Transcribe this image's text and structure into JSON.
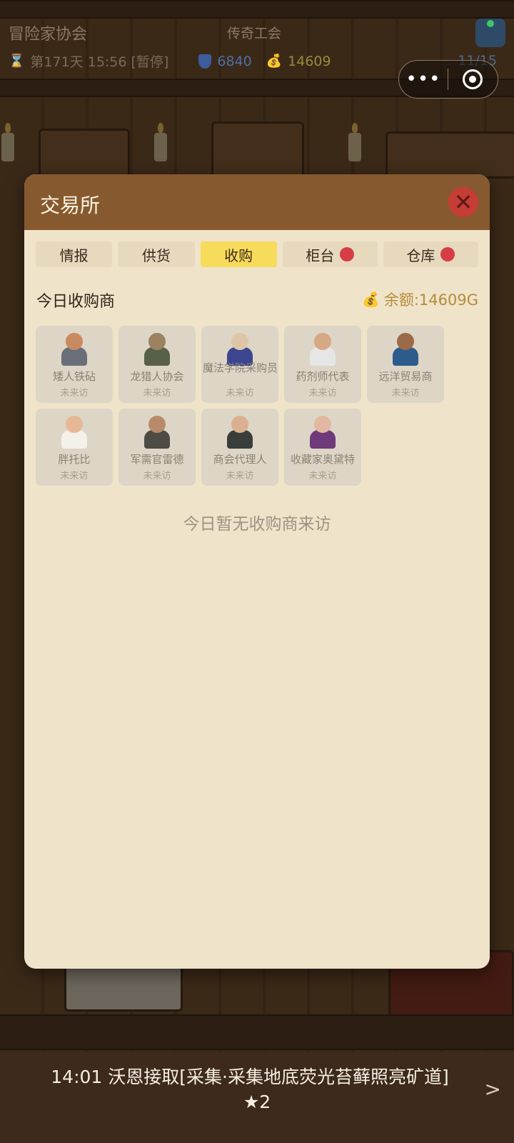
{
  "hud": {
    "guild_name": "冒险家协会",
    "guild_rank": "传奇工会",
    "day_time": "第171天 15:56 [暂停]",
    "reputation": "6840",
    "gold": "14609",
    "members": "11/15"
  },
  "modal": {
    "title": "交易所",
    "tabs": [
      {
        "label": "情报",
        "active": false,
        "badge": false
      },
      {
        "label": "供货",
        "active": false,
        "badge": false
      },
      {
        "label": "收购",
        "active": true,
        "badge": false
      },
      {
        "label": "柜台",
        "active": false,
        "badge": true
      },
      {
        "label": "仓库",
        "active": false,
        "badge": true
      }
    ],
    "section_title": "今日收购商",
    "balance": "余额:14609G",
    "buyers": [
      {
        "name": "矮人铁砧",
        "status": "未来访",
        "skin": "#c98a62",
        "outfit": "#6a6e78"
      },
      {
        "name": "龙猎人协会",
        "status": "未来访",
        "skin": "#9b8260",
        "outfit": "#58604a"
      },
      {
        "name": "魔法学院采购员",
        "status": "未来访",
        "skin": "#e0c6a8",
        "outfit": "#3c4690"
      },
      {
        "name": "药剂师代表",
        "status": "未来访",
        "skin": "#d7a884",
        "outfit": "#e6e6e6"
      },
      {
        "name": "远洋贸易商",
        "status": "未来访",
        "skin": "#9c6a46",
        "outfit": "#2d5b8c"
      },
      {
        "name": "胖托比",
        "status": "未来访",
        "skin": "#e7b896",
        "outfit": "#f4f0ea"
      },
      {
        "name": "军需官雷德",
        "status": "未来访",
        "skin": "#b98a6a",
        "outfit": "#4e4a44"
      },
      {
        "name": "商会代理人",
        "status": "未来访",
        "skin": "#d9b090",
        "outfit": "#3a3e3a"
      },
      {
        "name": "收藏家奥黛特",
        "status": "未来访",
        "skin": "#e2b8a0",
        "outfit": "#6e3a7a"
      }
    ],
    "empty_message": "今日暂无收购商来访"
  },
  "ticker": {
    "line1": "14:01 沃恩接取[采集·采集地底荧光苔藓照亮矿道]",
    "line2": "★2"
  },
  "colors": {
    "header": "#87592e",
    "panel": "#efe3ca",
    "active_tab": "#f7db5a",
    "badge": "#d63d44",
    "close": "#c63d35"
  }
}
